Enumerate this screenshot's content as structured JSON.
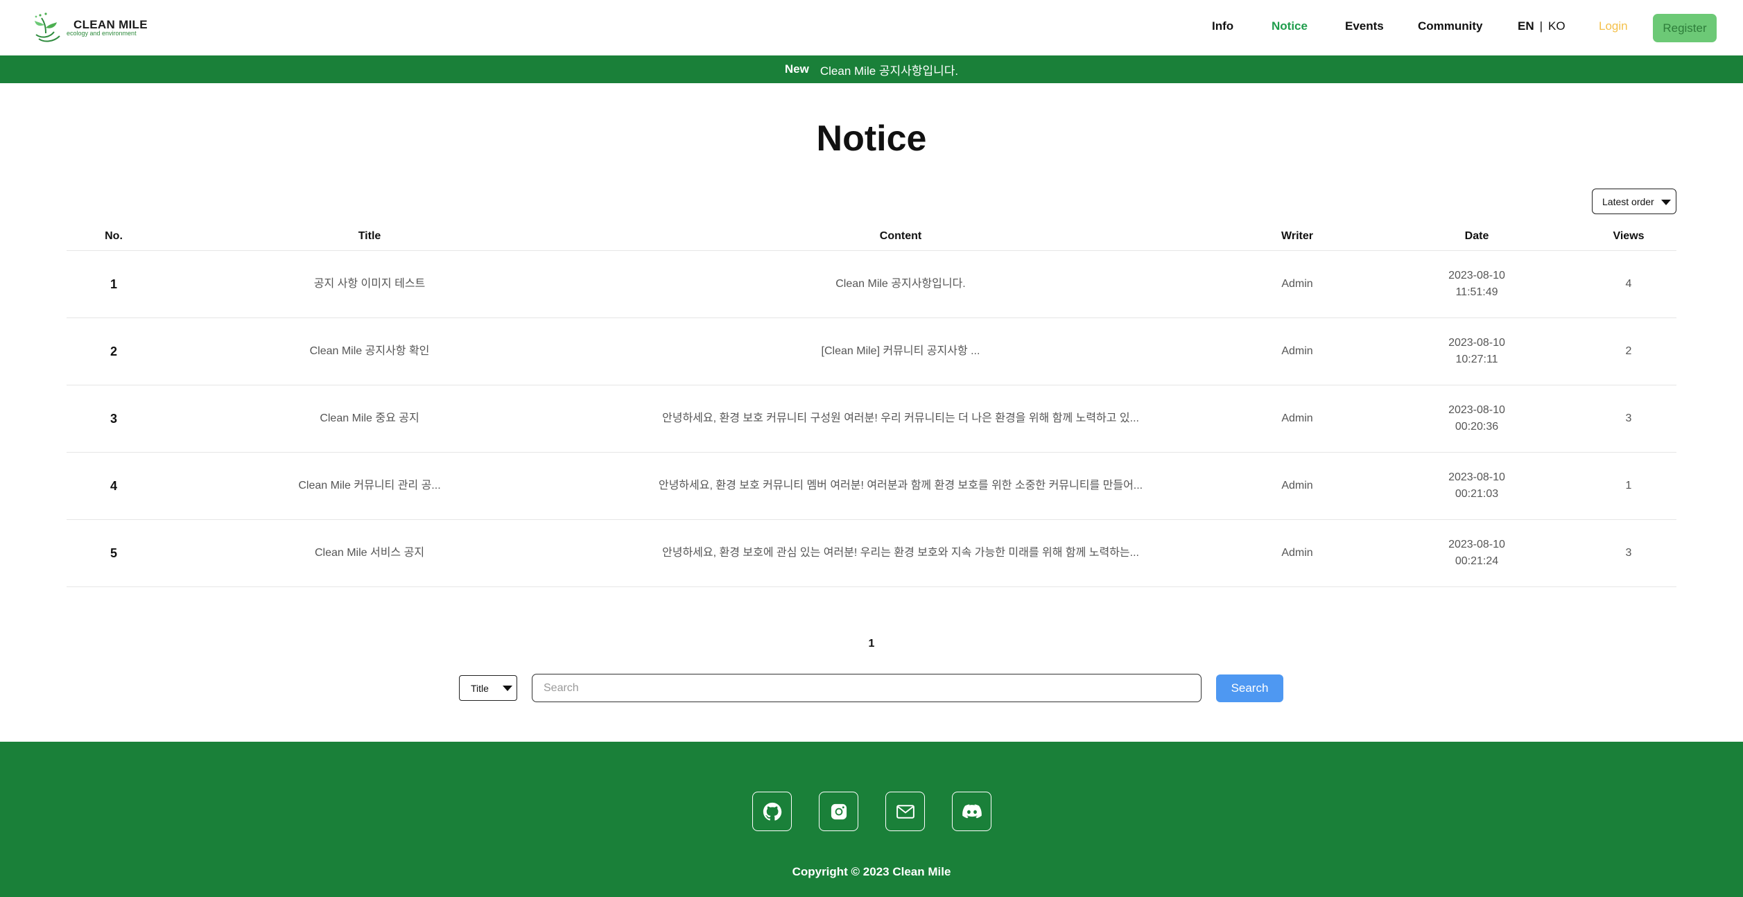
{
  "header": {
    "logo_title": "CLEAN MILE",
    "logo_subtitle": "ecology and environment",
    "nav": {
      "info": "Info",
      "notice": "Notice",
      "events": "Events",
      "community": "Community"
    },
    "lang": {
      "en": "EN",
      "separator": "|",
      "ko": "KO"
    },
    "login": "Login",
    "register": "Register"
  },
  "banner": {
    "tag": "New",
    "text": "Clean Mile 공지사항입니다."
  },
  "page": {
    "title": "Notice"
  },
  "sort": {
    "selected": "Latest order"
  },
  "table": {
    "headers": {
      "no": "No.",
      "title": "Title",
      "content": "Content",
      "writer": "Writer",
      "date": "Date",
      "views": "Views"
    },
    "rows": [
      {
        "no": "1",
        "title": "공지 사항 이미지 테스트",
        "content": "Clean Mile 공지사항입니다.",
        "writer": "Admin",
        "date": "2023-08-10",
        "time": "11:51:49",
        "views": "4"
      },
      {
        "no": "2",
        "title": "Clean Mile 공지사항 확인",
        "content": "[Clean Mile] 커뮤니티 공지사항 ...",
        "writer": "Admin",
        "date": "2023-08-10",
        "time": "10:27:11",
        "views": "2"
      },
      {
        "no": "3",
        "title": "Clean Mile 중요 공지",
        "content": "안녕하세요, 환경 보호 커뮤니티 구성원 여러분! 우리 커뮤니티는 더 나은 환경을 위해 함께 노력하고 있...",
        "writer": "Admin",
        "date": "2023-08-10",
        "time": "00:20:36",
        "views": "3"
      },
      {
        "no": "4",
        "title": "Clean Mile 커뮤니티 관리 공...",
        "content": "안녕하세요, 환경 보호 커뮤니티 멤버 여러분! 여러분과 함께 환경 보호를 위한 소중한 커뮤니티를 만들어...",
        "writer": "Admin",
        "date": "2023-08-10",
        "time": "00:21:03",
        "views": "1"
      },
      {
        "no": "5",
        "title": "Clean Mile 서비스 공지",
        "content": "안녕하세요, 환경 보호에 관심 있는 여러분! 우리는 환경 보호와 지속 가능한 미래를 위해 함께 노력하는...",
        "writer": "Admin",
        "date": "2023-08-10",
        "time": "00:21:24",
        "views": "3"
      }
    ]
  },
  "pagination": {
    "current": "1"
  },
  "search": {
    "type_selected": "Title",
    "placeholder": "Search",
    "value": "",
    "button": "Search"
  },
  "footer": {
    "icons": [
      "github-icon",
      "instagram-icon",
      "mail-icon",
      "discord-icon"
    ],
    "copyright": "Copyright © 2023 Clean Mile"
  },
  "colors": {
    "brand_green": "#1a8039",
    "active_nav": "#1f9d4c",
    "login": "#f4c04a",
    "register_bg": "#6cc976",
    "search_button": "#4e98f2"
  }
}
